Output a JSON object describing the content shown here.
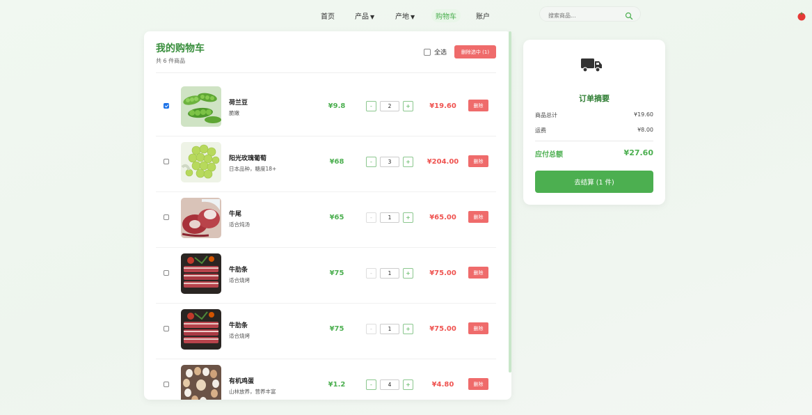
{
  "nav": {
    "items": [
      {
        "label": "首页",
        "caret": ""
      },
      {
        "label": "产品",
        "caret": "▼"
      },
      {
        "label": "产地",
        "caret": "▼"
      },
      {
        "label": "购物车",
        "caret": ""
      },
      {
        "label": "账户",
        "caret": ""
      }
    ],
    "active": "购物车",
    "search_placeholder": "搜索商品..."
  },
  "cart": {
    "title": "我的购物车",
    "count_text": "共 6 件商品",
    "select_all_label": "全选",
    "delete_selected_label": "删除选中 (1)",
    "items": [
      {
        "name": "荷兰豆",
        "desc": "脆嫩",
        "price": "¥9.8",
        "qty": "2",
        "subtotal": "¥19.60",
        "checked": true,
        "delete": "删除",
        "minus": "-",
        "plus": "+",
        "image_icon": "snow-pea-photo"
      },
      {
        "name": "阳光玫瑰葡萄",
        "desc": "日本品种，糖度18+",
        "price": "¥68",
        "qty": "3",
        "subtotal": "¥204.00",
        "checked": false,
        "delete": "删除",
        "minus": "-",
        "plus": "+",
        "image_icon": "grape-photo"
      },
      {
        "name": "牛尾",
        "desc": "适合炖汤",
        "price": "¥65",
        "qty": "1",
        "subtotal": "¥65.00",
        "checked": false,
        "delete": "删除",
        "minus": "-",
        "plus": "+",
        "image_icon": "oxtail-photo"
      },
      {
        "name": "牛肋条",
        "desc": "适合烧烤",
        "price": "¥75",
        "qty": "1",
        "subtotal": "¥75.00",
        "checked": false,
        "delete": "删除",
        "minus": "-",
        "plus": "+",
        "image_icon": "beef-rib-photo"
      },
      {
        "name": "牛肋条",
        "desc": "适合烧烤",
        "price": "¥75",
        "qty": "1",
        "subtotal": "¥75.00",
        "checked": false,
        "delete": "删除",
        "minus": "-",
        "plus": "+",
        "image_icon": "beef-rib-photo"
      },
      {
        "name": "有机鸡蛋",
        "desc": "山林放养，营养丰富",
        "price": "¥1.2",
        "qty": "4",
        "subtotal": "¥4.80",
        "checked": false,
        "delete": "删除",
        "minus": "-",
        "plus": "+",
        "image_icon": "eggs-photo"
      }
    ]
  },
  "summary": {
    "icon": "truck-icon",
    "title": "订单摘要",
    "goods_label": "商品总计",
    "goods_value": "¥19.60",
    "shipping_label": "运费",
    "shipping_value": "¥8.00",
    "total_label": "应付总额",
    "total_value": "¥27.60",
    "checkout_label": "去结算 (1 件)"
  },
  "colors": {
    "accent": "#4caf50",
    "danger": "#ef6b6b",
    "title_green": "#388e3c"
  }
}
